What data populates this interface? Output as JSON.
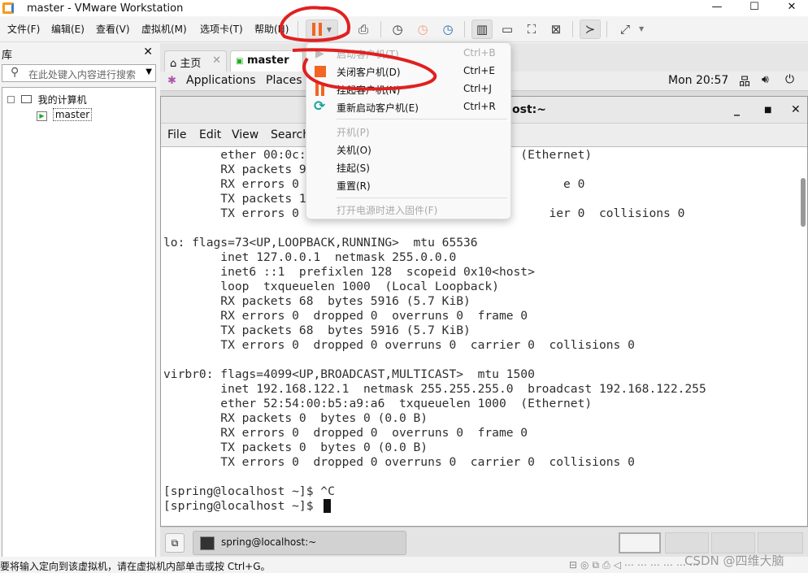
{
  "window": {
    "title": "master - VMware Workstation",
    "minimize": "—",
    "maximize": "☐",
    "close": "✕"
  },
  "menubar": [
    "文件(F)",
    "编辑(E)",
    "查看(V)",
    "虚拟机(M)",
    "选项卡(T)",
    "帮助(H)"
  ],
  "library": {
    "title": "库",
    "close": "✕",
    "search_placeholder": "在此处键入内容进行搜索",
    "tree": {
      "root": "我的计算机",
      "child": "master"
    }
  },
  "tabs": [
    {
      "label": "主页",
      "close": "✕"
    },
    {
      "label": "master",
      "close": "✕"
    }
  ],
  "gnome": {
    "applications": "Applications",
    "places": "Places",
    "clock": "Mon 20:57"
  },
  "terminal": {
    "title": "spring@localhost:~",
    "menu": [
      "File",
      "Edit",
      "View",
      "Search"
    ],
    "lines": [
      "        ether 00:0c:                              (Ethernet)",
      "        RX packets 9",
      "        RX errors 0                                     e 0",
      "        TX packets 1",
      "        TX errors 0                                   ier 0  collisions 0",
      "",
      "lo: flags=73<UP,LOOPBACK,RUNNING>  mtu 65536",
      "        inet 127.0.0.1  netmask 255.0.0.0",
      "        inet6 ::1  prefixlen 128  scopeid 0x10<host>",
      "        loop  txqueuelen 1000  (Local Loopback)",
      "        RX packets 68  bytes 5916 (5.7 KiB)",
      "        RX errors 0  dropped 0  overruns 0  frame 0",
      "        TX packets 68  bytes 5916 (5.7 KiB)",
      "        TX errors 0  dropped 0 overruns 0  carrier 0  collisions 0",
      "",
      "virbr0: flags=4099<UP,BROADCAST,MULTICAST>  mtu 1500",
      "        inet 192.168.122.1  netmask 255.255.255.0  broadcast 192.168.122.255",
      "        ether 52:54:00:b5:a9:a6  txqueuelen 1000  (Ethernet)",
      "        RX packets 0  bytes 0 (0.0 B)",
      "        RX errors 0  dropped 0  overruns 0  frame 0",
      "        TX packets 0  bytes 0 (0.0 B)",
      "        TX errors 0  dropped 0 overruns 0  carrier 0  collisions 0",
      "",
      "[spring@localhost ~]$ ^C",
      "[spring@localhost ~]$ "
    ]
  },
  "taskbar": {
    "window": "spring@localhost:~"
  },
  "power_menu": {
    "items": [
      {
        "label": "启动客户机(T)",
        "shortcut": "Ctrl+B",
        "disabled": true,
        "icon": "play-icon"
      },
      {
        "label": "关闭客户机(D)",
        "shortcut": "Ctrl+E",
        "disabled": false,
        "icon": "stop-icon"
      },
      {
        "label": "挂起客户机(N)",
        "shortcut": "Ctrl+J",
        "disabled": false,
        "icon": "pause-icon"
      },
      {
        "label": "重新启动客户机(E)",
        "shortcut": "Ctrl+R",
        "disabled": false,
        "icon": "restart-icon"
      },
      {
        "label": "开机(P)",
        "disabled": true
      },
      {
        "label": "关机(O)",
        "disabled": false
      },
      {
        "label": "挂起(S)",
        "disabled": false
      },
      {
        "label": "重置(R)",
        "disabled": false
      },
      {
        "label": "打开电源时进入固件(F)",
        "disabled": true
      }
    ]
  },
  "status": {
    "text": "要将输入定向到该虚拟机，请在虚拟机内部单击或按 Ctrl+G。",
    "watermark": "CSDN @四维大脑"
  },
  "colors": {
    "accent_orange": "#f26522",
    "annotation_red": "#e02020",
    "restart_teal": "#17a398"
  }
}
